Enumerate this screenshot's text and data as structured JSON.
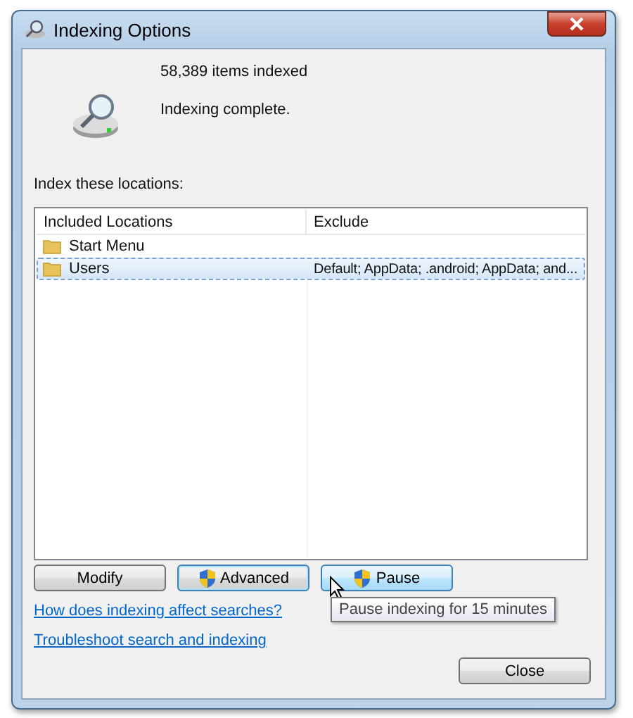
{
  "window": {
    "title": "Indexing Options"
  },
  "status": {
    "items_indexed": "58,389 items indexed",
    "message": "Indexing complete."
  },
  "locations_label": "Index these locations:",
  "table": {
    "columns": [
      "Included Locations",
      "Exclude"
    ],
    "rows": [
      {
        "location": "Start Menu",
        "exclude": "",
        "selected": false
      },
      {
        "location": "Users",
        "exclude": "Default; AppData; .android; AppData; and...",
        "selected": true
      }
    ]
  },
  "buttons": [
    {
      "label": "Modify",
      "shield": false,
      "focused": false,
      "hovered": false
    },
    {
      "label": "Advanced",
      "shield": true,
      "focused": true,
      "hovered": false
    },
    {
      "label": "Pause",
      "shield": true,
      "focused": false,
      "hovered": true
    }
  ],
  "tooltip": "Pause indexing for 15 minutes",
  "links": [
    "How does indexing affect searches?",
    "Troubleshoot search and indexing"
  ],
  "close_button": "Close"
}
